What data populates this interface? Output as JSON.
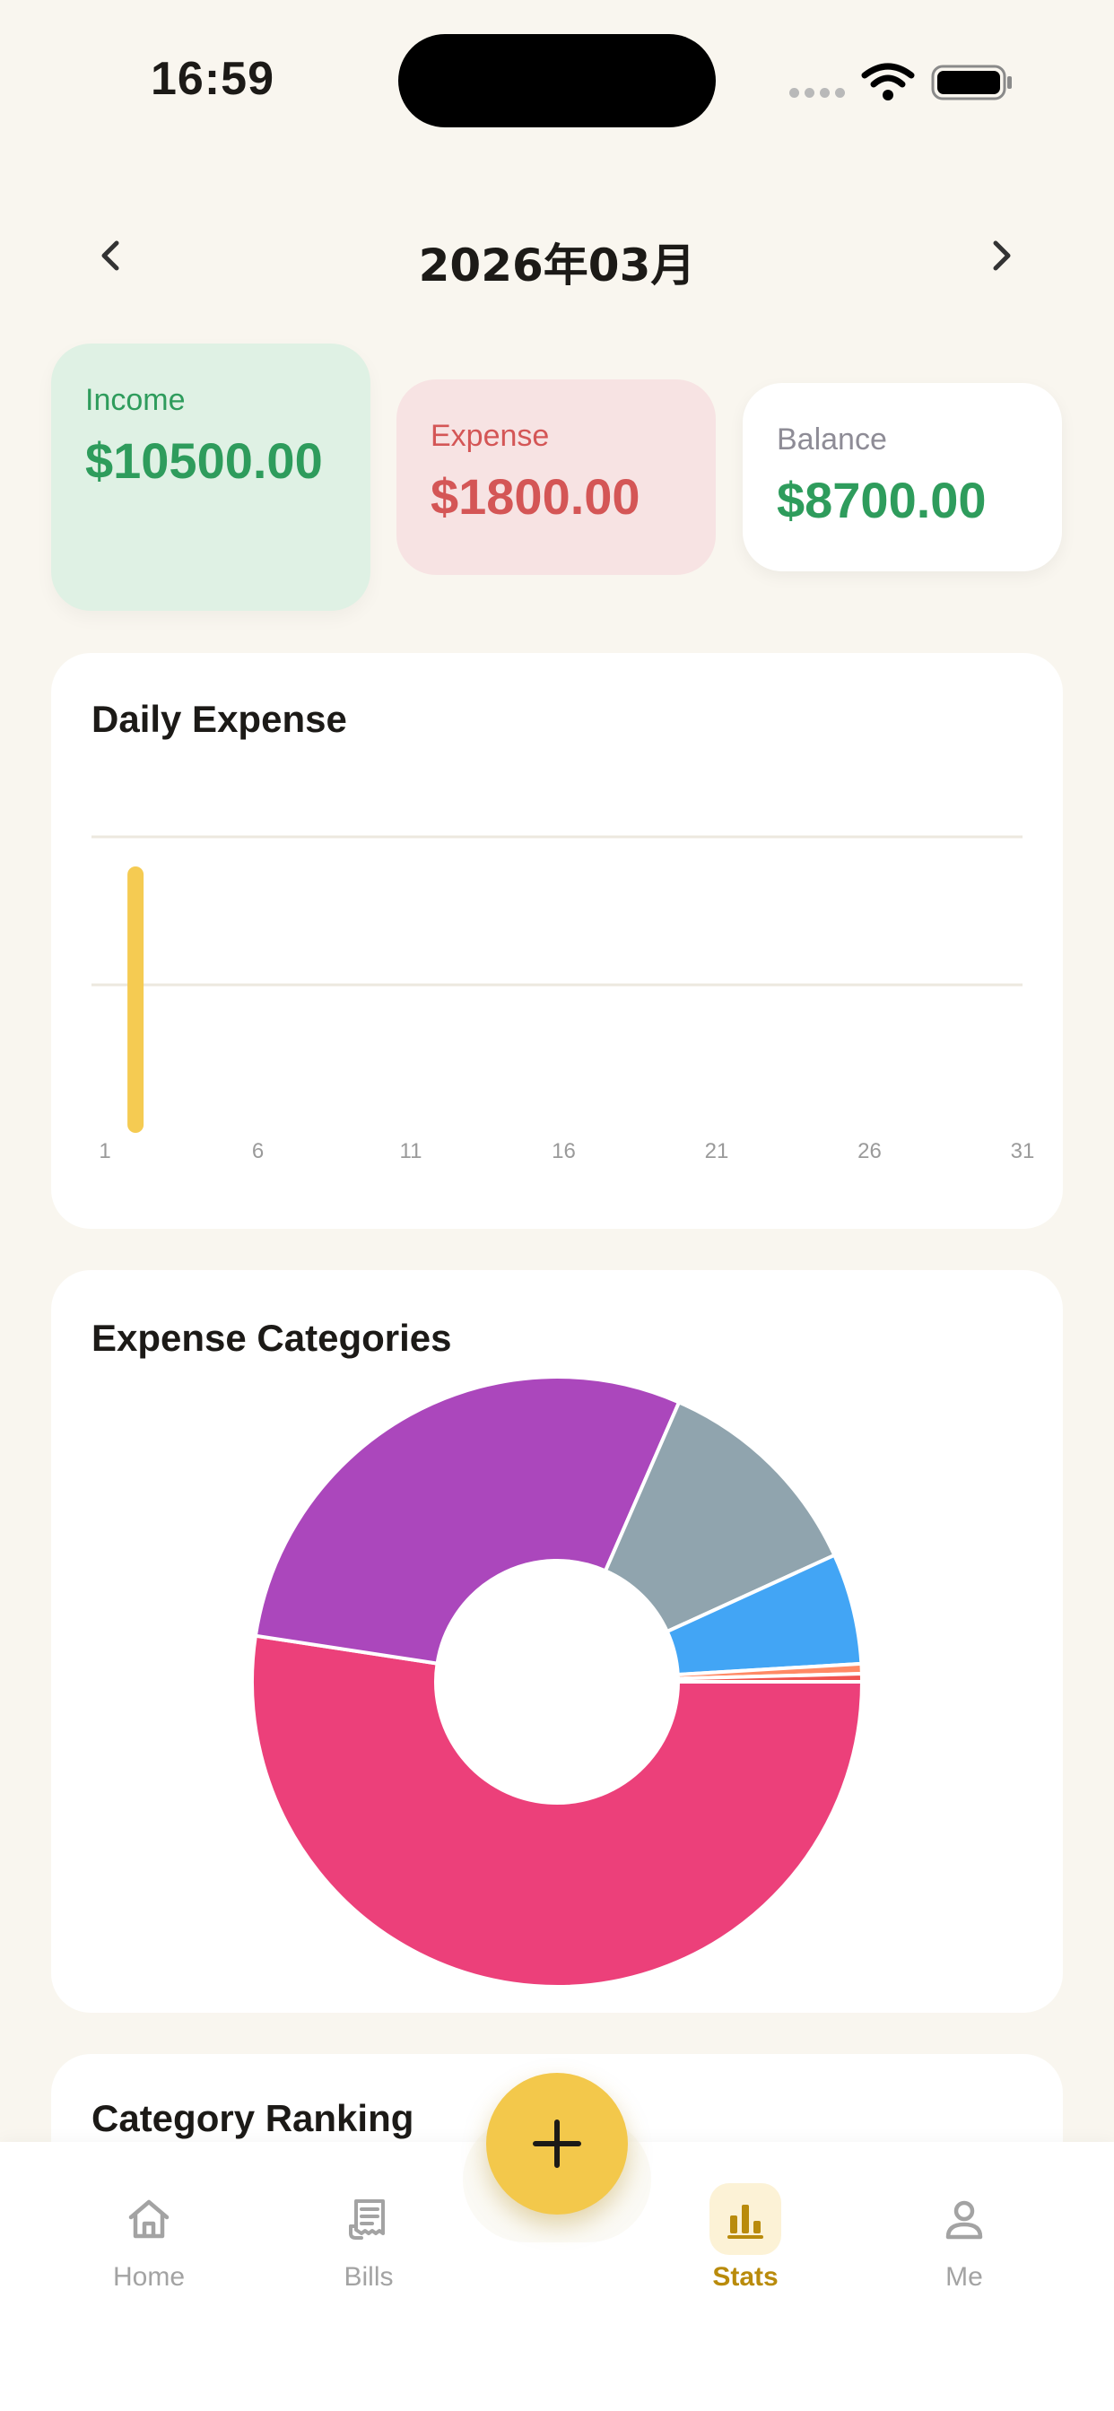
{
  "status_bar": {
    "time": "16:59"
  },
  "header": {
    "month_title": "2026年03月"
  },
  "summary": {
    "income": {
      "label": "Income",
      "value": "$10500.00",
      "color": "#2e9c5c"
    },
    "expense": {
      "label": "Expense",
      "value": "$1800.00",
      "color": "#d45656"
    },
    "balance": {
      "label": "Balance",
      "value": "$8700.00",
      "color": "#2e9c5c"
    }
  },
  "daily_expense": {
    "title": "Daily Expense"
  },
  "expense_categories": {
    "title": "Expense Categories"
  },
  "category_ranking": {
    "title": "Category Ranking"
  },
  "tabbar": {
    "home": {
      "label": "Home",
      "icon": "home-icon"
    },
    "bills": {
      "label": "Bills",
      "icon": "receipt-icon"
    },
    "add": {
      "icon": "plus-icon"
    },
    "stats": {
      "label": "Stats",
      "icon": "bar-chart-icon",
      "active": true
    },
    "me": {
      "label": "Me",
      "icon": "user-icon"
    }
  },
  "colors": {
    "accent": "#f3c84b",
    "background": "#f9f6ef",
    "active_tab": "#b98b0c"
  },
  "chart_data": [
    {
      "type": "bar",
      "x": [
        1,
        2,
        3,
        4,
        5,
        6,
        7,
        8,
        9,
        10,
        11,
        12,
        13,
        14,
        15,
        16,
        17,
        18,
        19,
        20,
        21,
        22,
        23,
        24,
        25,
        26,
        27,
        28,
        29,
        30,
        31
      ],
      "values": [
        0,
        1800,
        0,
        0,
        0,
        0,
        0,
        0,
        0,
        0,
        0,
        0,
        0,
        0,
        0,
        0,
        0,
        0,
        0,
        0,
        0,
        0,
        0,
        0,
        0,
        0,
        0,
        0,
        0,
        0,
        0
      ],
      "xticks": [
        1,
        6,
        11,
        16,
        21,
        26,
        31
      ],
      "ylim": [
        0,
        2000
      ],
      "grid": true,
      "bar_color": "#f5cb52"
    },
    {
      "type": "pie",
      "donut": true,
      "slices": [
        {
          "value": 50.0,
          "color": "#ec407a"
        },
        {
          "value": 27.8,
          "color": "#ab47bc"
        },
        {
          "value": 11.1,
          "color": "#90a4ae"
        },
        {
          "value": 5.6,
          "color": "#42a5f5"
        },
        {
          "value": 0.5,
          "color": "#ff8a65"
        },
        {
          "value": 0.4,
          "color": "#ef5350"
        }
      ]
    }
  ]
}
